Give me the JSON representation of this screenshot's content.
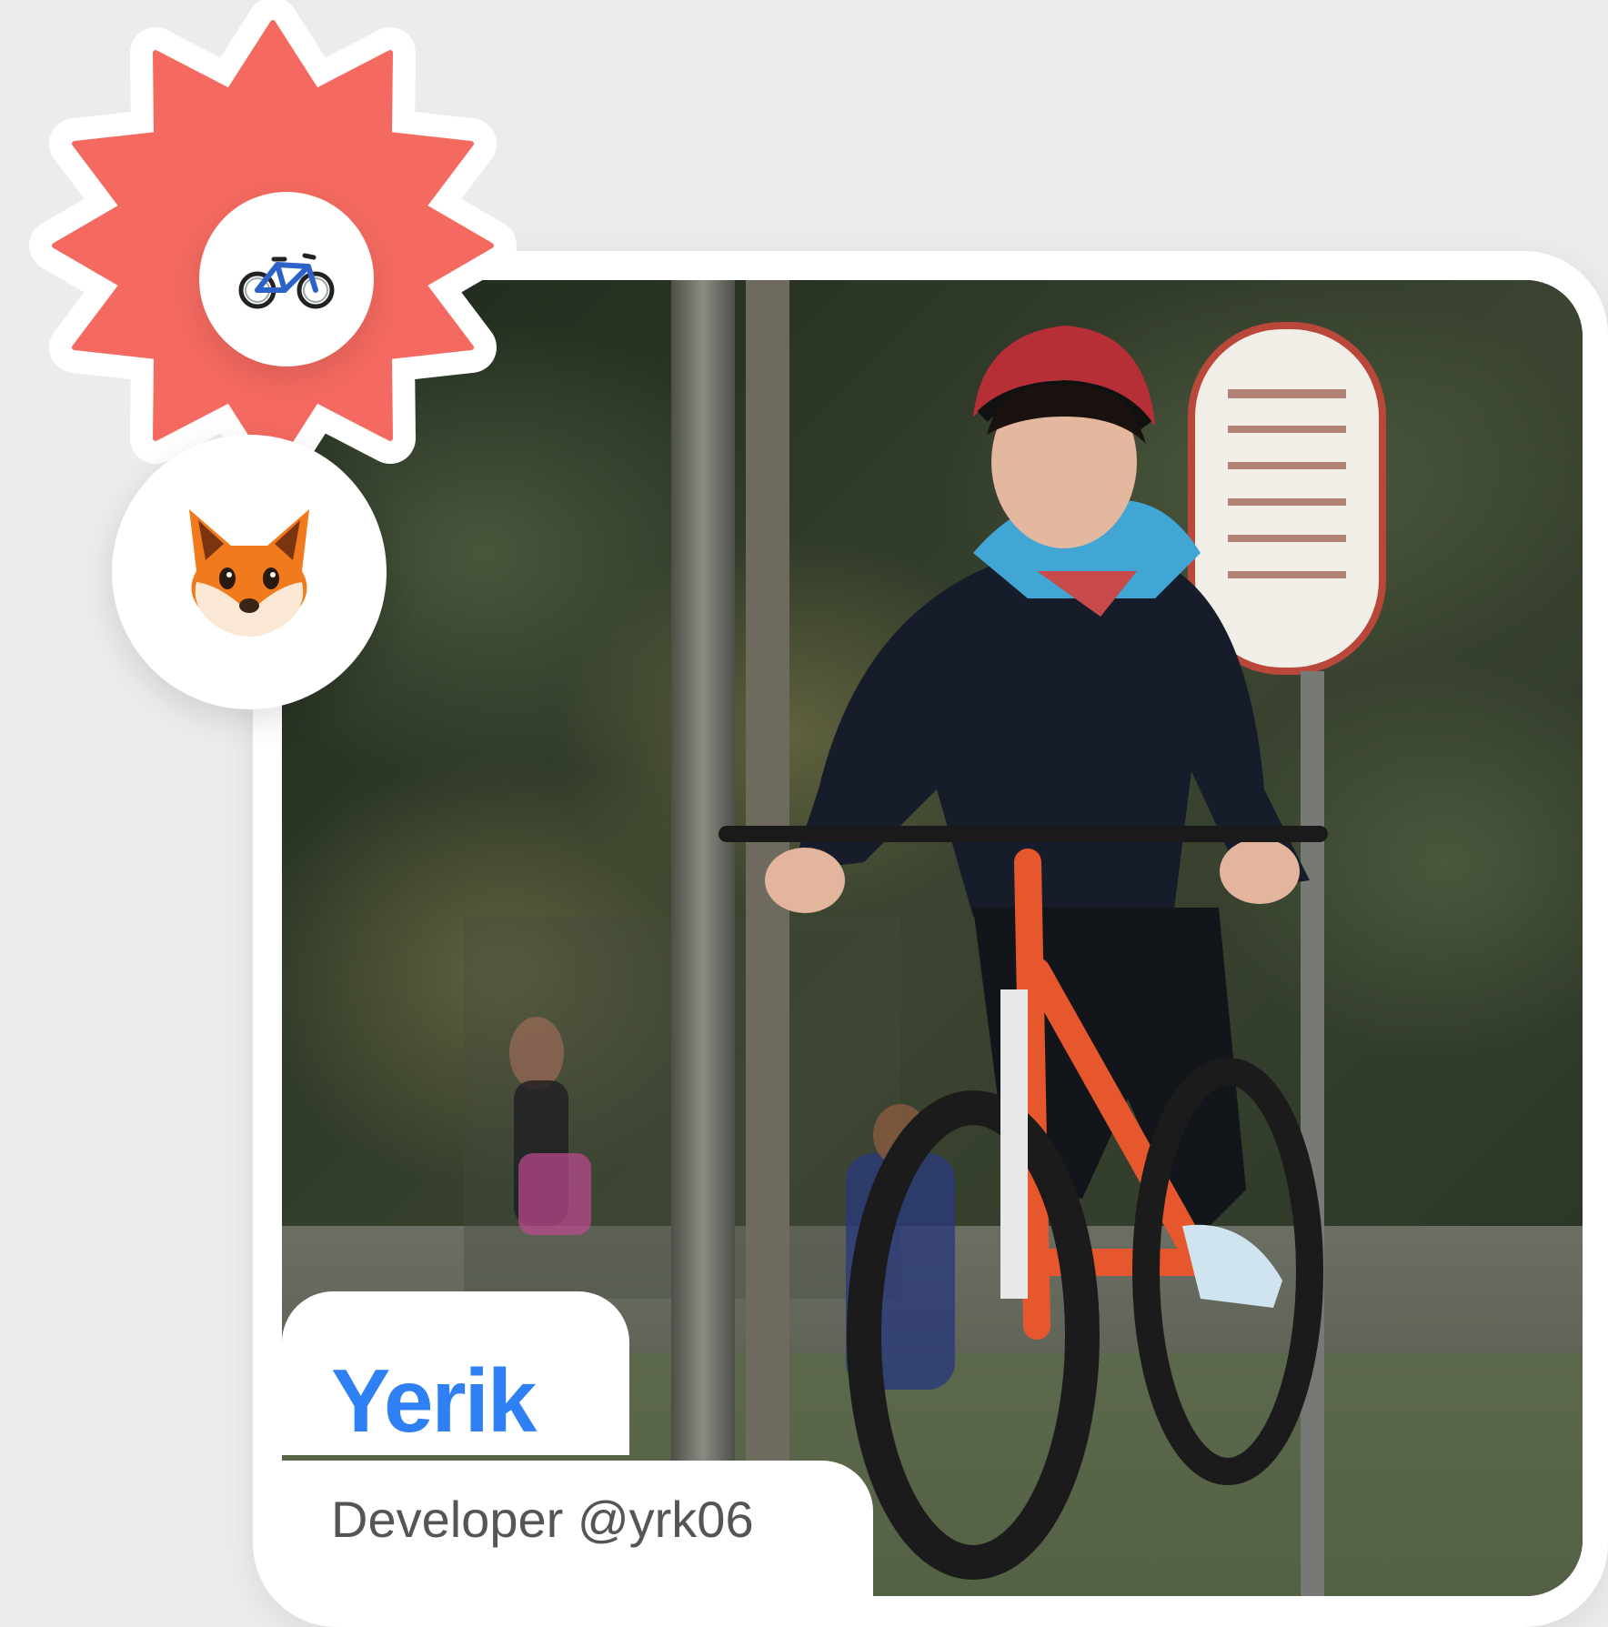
{
  "profile": {
    "name": "Yerik",
    "role": "Developer @yrk06"
  },
  "badges": {
    "activity_icon": "bicycle-icon",
    "avatar_icon": "fox-face-icon"
  },
  "colors": {
    "burst": "#f56a60",
    "name": "#2f80f5",
    "role": "#555555",
    "background": "#ececec",
    "card": "#ffffff"
  }
}
